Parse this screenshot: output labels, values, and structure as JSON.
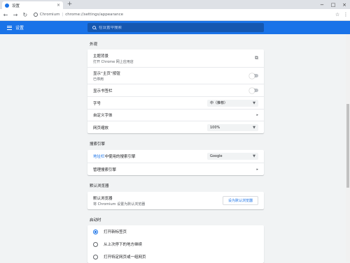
{
  "browser": {
    "tab_title": "设置",
    "tab_close": "×",
    "new_tab": "+",
    "win_min": "−",
    "win_max": "□",
    "win_close": "×",
    "back": "←",
    "forward": "→",
    "reload": "↻",
    "site_label": "Chromium",
    "url": "chrome://settings/appearance",
    "star": "☆",
    "menu": "⋮"
  },
  "header": {
    "title": "设置",
    "search_placeholder": "在设置中搜索"
  },
  "appearance": {
    "title": "外观",
    "theme_label": "主题背景",
    "theme_sub": "打开 Chrome 网上应用店",
    "home_label": "显示“主页”按钮",
    "home_sub": "已停用",
    "bookmarks_label": "显示书签栏",
    "font_size_label": "字号",
    "font_size_value": "中（推荐）",
    "custom_font_label": "自定义字体",
    "zoom_label": "网页缩放",
    "zoom_value": "100%"
  },
  "search_engine": {
    "title": "搜索引擎",
    "used_prefix": "地址栏",
    "used_suffix": "中使用的搜索引擎",
    "engine_value": "Google",
    "manage_label": "管理搜索引擎"
  },
  "default_browser": {
    "title": "默认浏览器",
    "label": "默认浏览器",
    "sub": "将 Chromium 设置为默认浏览器",
    "button": "设为默认浏览器"
  },
  "startup": {
    "title": "启动时",
    "options": [
      "打开新标签页",
      "从上次停下的地方继续",
      "打开特定网页或一组网页"
    ],
    "selected": 0
  },
  "colors": {
    "accent": "#1a73e8",
    "header_bg": "#1a73e8",
    "search_bg": "#1557b0"
  }
}
